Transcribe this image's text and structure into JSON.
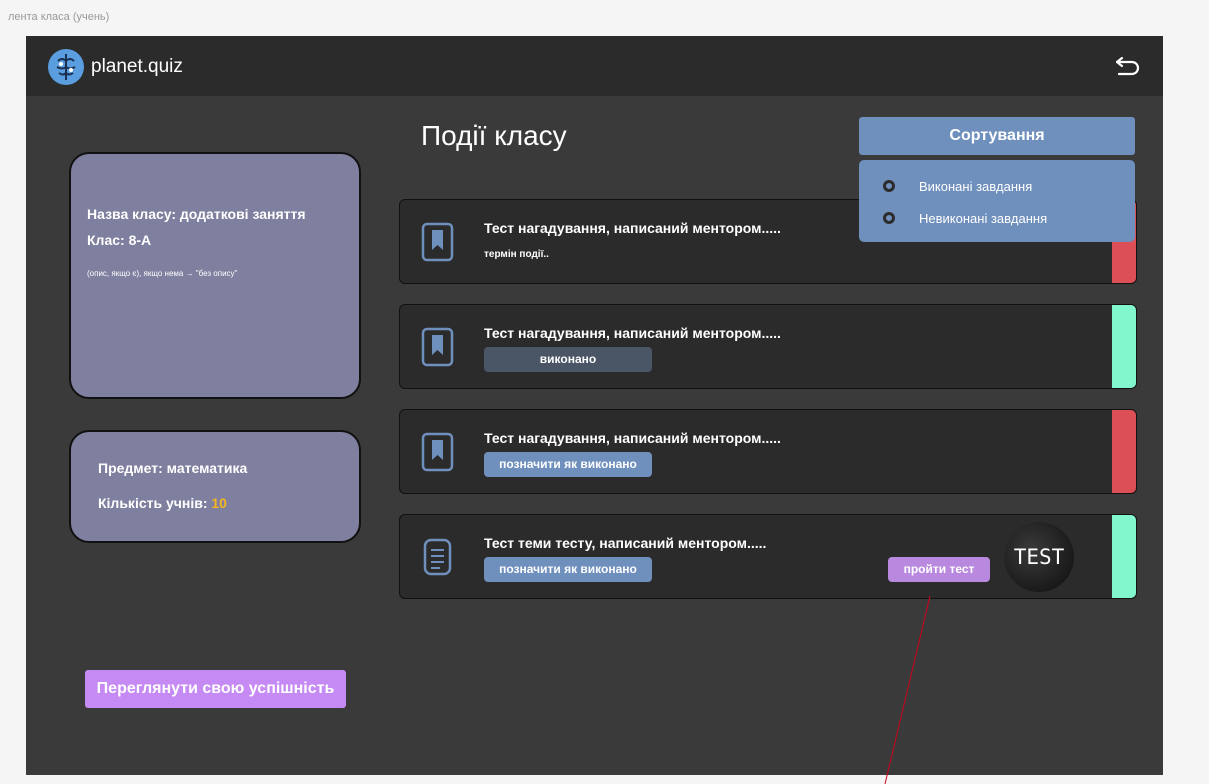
{
  "frame_label": "лента класа (учень)",
  "header": {
    "brand": "planet.quiz",
    "logo_icon": "brain-globe-icon",
    "back_icon": "undo-arrow-icon"
  },
  "page_title": "Події класу",
  "class_info": {
    "name_line": "Назва класу: додаткові заняття",
    "grade_line": "Клас: 8-А",
    "description": "(опис, якщо є), якщо нема → \"без опису\""
  },
  "subject_info": {
    "subject_line": "Предмет: математика",
    "students_label": "Кількість учнів: ",
    "students_count": "10"
  },
  "performance_button": "Переглянути свою успішність",
  "sort": {
    "button": "Сортування",
    "options": [
      "Виконані завдання",
      "Невиконані завдання"
    ]
  },
  "events": [
    {
      "title": "Тест нагадування, написаний ментором.....",
      "subtitle": "термін події..",
      "status_color": "#dc4f56",
      "icon": "bookmark-icon"
    },
    {
      "title": "Тест нагадування, написаний ментором.....",
      "pill": "виконано",
      "status_color": "#82f6cd",
      "icon": "bookmark-icon"
    },
    {
      "title": "Тест нагадування, написаний ментором.....",
      "pill": "позначити як виконано",
      "status_color": "#dc4f56",
      "icon": "bookmark-icon"
    },
    {
      "title": "Тест теми тесту, написаний ментором.....",
      "pill": "позначити як виконано",
      "test_button": "пройти тест",
      "image_text": "TEST",
      "status_color": "#82f6cd",
      "icon": "document-icon"
    }
  ],
  "colors": {
    "accent_blue": "#6f8fbc",
    "accent_purple": "#c58af4",
    "pending": "#dc4f56",
    "done": "#82f6cd"
  }
}
